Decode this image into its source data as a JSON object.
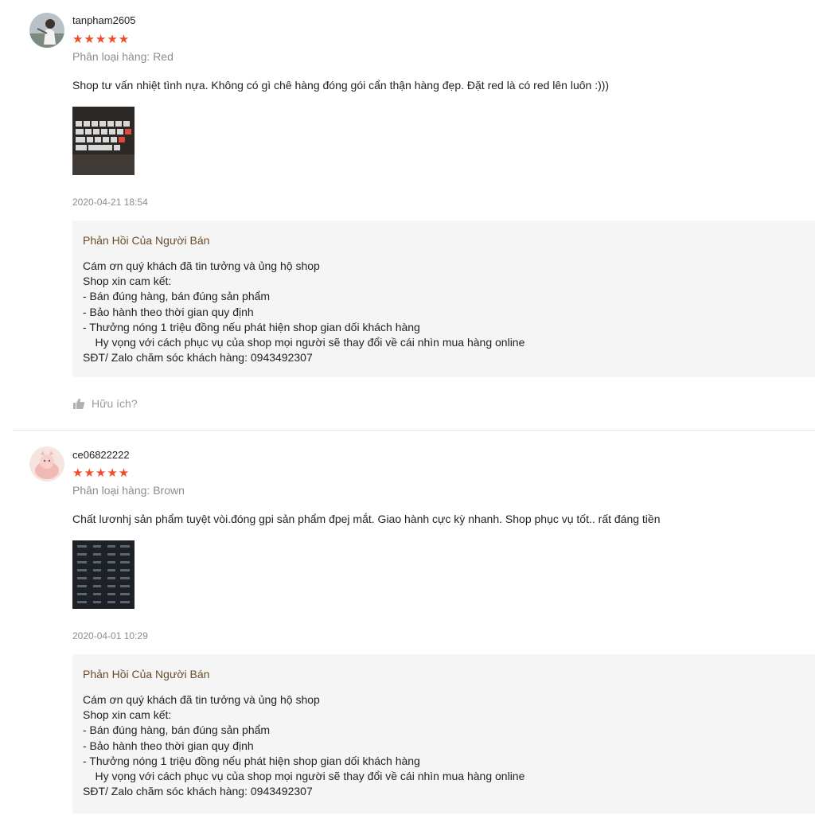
{
  "reviews": [
    {
      "author": "tanpham2605",
      "stars": "★★★★★",
      "variation": "Phân loại hàng: Red",
      "comment": "Shop tư vấn nhiệt tình nựa. Không có gì chê hàng đóng gói cẩn thận hàng đẹp. Đặt red là có red lên luôn :)))",
      "date": "2020-04-21 18:54",
      "seller_title": "Phản Hồi Của Người Bán",
      "seller_reply": "Cám ơn quý khách đã tin tưởng và ủng hộ shop\nShop xin cam kết:\n- Bán đúng hàng, bán đúng sản phẩm\n- Bảo hành theo thời gian quy định\n- Thưởng nóng 1 triệu đồng nếu phát hiện shop gian dối khách hàng\n    Hy vọng với cách phục vụ của shop mọi người sẽ thay đổi về cái nhìn mua hàng online\nSĐT/ Zalo chăm sóc khách hàng: 0943492307",
      "helpful": "Hữu ích?"
    },
    {
      "author": "ce06822222",
      "stars": "★★★★★",
      "variation": "Phân loại hàng: Brown",
      "comment": "Chất lươnhj sản phẩm tuyệt vòi.đóng gpi sản phẩm đpej mắt. Giao hành cực kỳ nhanh. Shop phục vụ tốt.. rất đáng tiền",
      "date": "2020-04-01 10:29",
      "seller_title": "Phản Hồi Của Người Bán",
      "seller_reply": "Cám ơn quý khách đã tin tưởng và ủng hộ shop\nShop xin cam kết:\n- Bán đúng hàng, bán đúng sản phẩm\n- Bảo hành theo thời gian quy định\n- Thưởng nóng 1 triệu đồng nếu phát hiện shop gian dối khách hàng\n    Hy vọng với cách phục vụ của shop mọi người sẽ thay đổi về cái nhìn mua hàng online\nSĐT/ Zalo chăm sóc khách hàng: 0943492307"
    }
  ],
  "colors": {
    "star": "#ee4d2d",
    "seller_title": "#6b4b2a",
    "seller_bg": "#f5f5f5",
    "muted": "#8c8c8c"
  },
  "icons": {
    "helpful": "thumbs-up-icon"
  }
}
